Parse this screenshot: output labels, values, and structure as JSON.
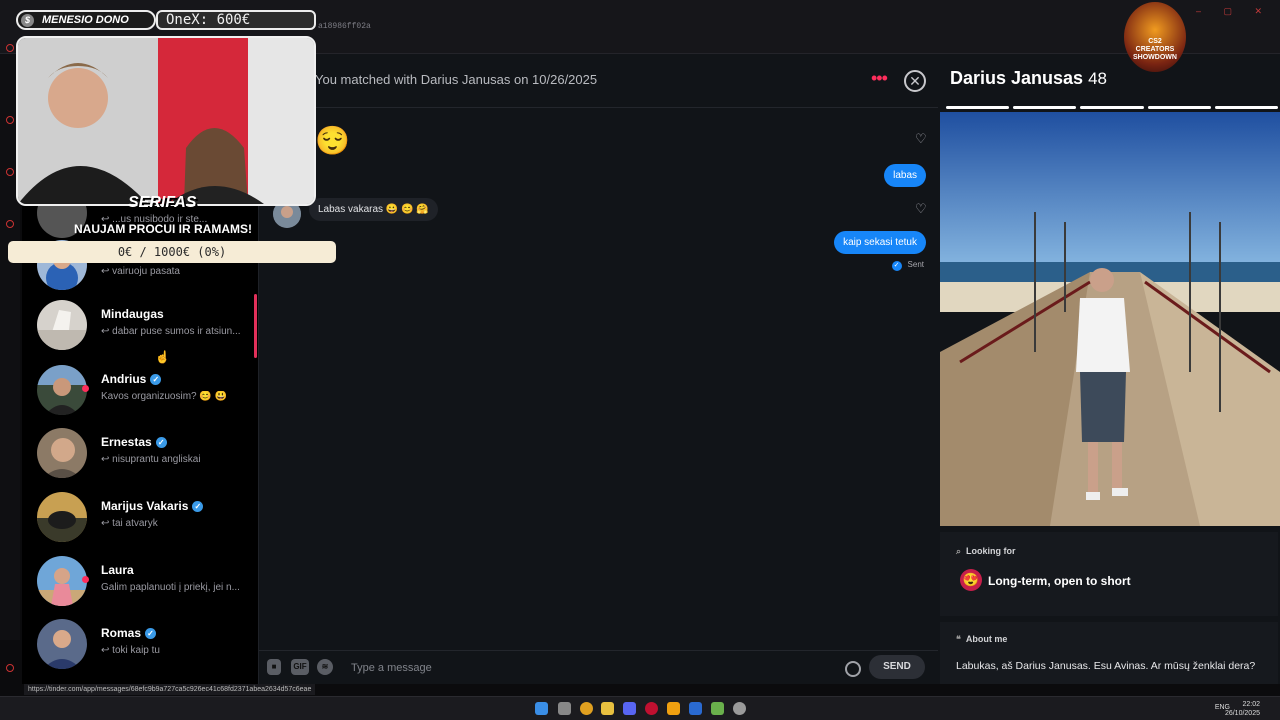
{
  "browser": {
    "url_hash": "a18986ff02a",
    "status_url": "https://tinder.com/app/messages/68efc9b9a727ca5c926ec41c68fd2371abea2634d57c6eae"
  },
  "matches": [
    {
      "name": "",
      "verified": false,
      "preview": "...us nusibodo ir ste...",
      "online": false
    },
    {
      "name": "",
      "verified": false,
      "preview": "vairuoju pasata",
      "online": false
    },
    {
      "name": "Mindaugas",
      "verified": false,
      "preview": "dabar puse sumos ir atsiun...",
      "online": false
    },
    {
      "name": "Andrius",
      "verified": true,
      "preview": "Kavos organizuosim? 😊 😃",
      "online": true
    },
    {
      "name": "Ernestas",
      "verified": true,
      "preview": "nisuprantu angliskai",
      "online": false
    },
    {
      "name": "Marijus Vakaris",
      "verified": true,
      "preview": "tai atvaryk",
      "online": false
    },
    {
      "name": "Laura",
      "verified": false,
      "preview": "Galim paplanuoti į priekį, jei n...",
      "online": true
    },
    {
      "name": "Romas",
      "verified": true,
      "preview": "toki kaip tu",
      "online": false
    }
  ],
  "chat": {
    "matched_text": "You matched with Darius Janusas on 10/26/2025",
    "big_emoji": "😌",
    "messages": [
      {
        "direction": "out",
        "text": "labas"
      },
      {
        "direction": "in",
        "text": "Labas vakaras 😀 😊 🤗"
      },
      {
        "direction": "out",
        "text": "kaip sekasi tetuk"
      }
    ],
    "sent_status": "Sent",
    "composer": {
      "gif_label": "GIF",
      "placeholder": "Type a message",
      "send_label": "SEND"
    }
  },
  "profile": {
    "name": "Darius Janusas",
    "age": "48",
    "photo_count": 5,
    "photo_index": 1,
    "looking_for_label": "Looking for",
    "looking_for_value": "Long-term, open to short",
    "looking_for_emoji": "😍",
    "about_label": "About me",
    "about_value": "Labukas, aš Darius Janusas. Esu Avinas. Ar mūsų ženklai dera?"
  },
  "overlay": {
    "dono_label": "MENESIO DONO",
    "dono_amount": "OneX: 600€",
    "goal_title": "SERIFAS",
    "goal_subtitle": "NAUJAM PROCUI IR RAMAMS!",
    "goal_progress": "0€ / 1000€ (0%)",
    "logo_text": "CS2 CREATORS SHOWDOWN"
  },
  "taskbar": {
    "language": "ENG",
    "time": "22:02",
    "date": "26/10/2025"
  },
  "colors": {
    "tinder_pink": "#fd2e5c",
    "bubble_blue": "#1786f8",
    "verified_blue": "#3a9ae8"
  }
}
